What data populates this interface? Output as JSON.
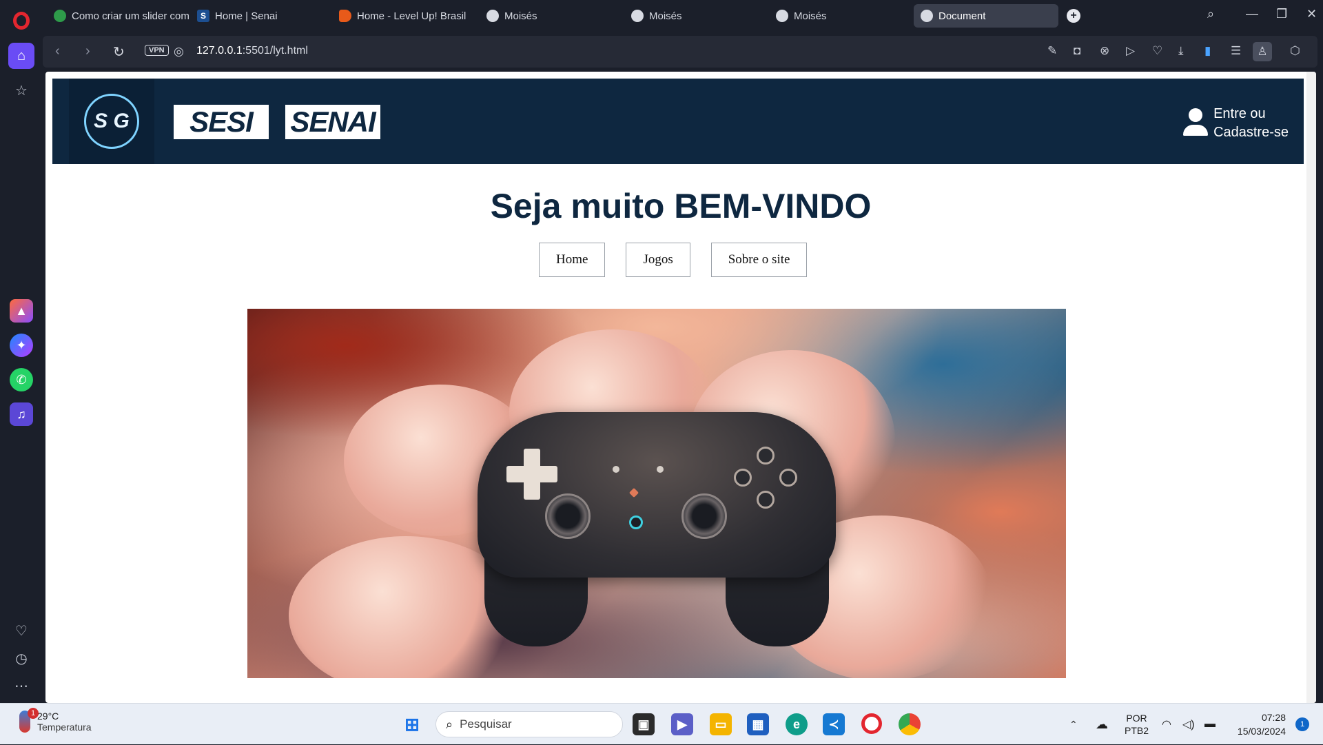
{
  "browser": {
    "tabs": [
      {
        "label": "Como criar um slider com",
        "favicon_color": "#2e9b4a"
      },
      {
        "label": "Home | Senai",
        "favicon_color": "#1d4f91",
        "favicon_text": "S"
      },
      {
        "label": "Home - Level Up! Brasil",
        "favicon_color": "#e85a1a"
      },
      {
        "label": "Moisés",
        "favicon_color": "#d7dae2"
      },
      {
        "label": "Moisés",
        "favicon_color": "#d7dae2"
      },
      {
        "label": "Moisés",
        "favicon_color": "#d7dae2"
      },
      {
        "label": "Document",
        "favicon_color": "#d7dae2",
        "active": true
      }
    ],
    "vpn_label": "VPN",
    "url_host": "127.0.0.1",
    "url_rest": ":5501/lyt.html"
  },
  "site": {
    "logo_text": "S G",
    "brand1": "SESI",
    "brand2": "SENAI",
    "login_line1": "Entre ou",
    "login_line2": "Cadastre-se",
    "welcome": "Seja muito BEM-VINDO",
    "menu": [
      "Home",
      "Jogos",
      "Sobre o site"
    ],
    "header_color": "#0e2740"
  },
  "taskbar": {
    "weather_temp": "29°C",
    "weather_label": "Temperatura",
    "weather_badge": "1",
    "search_placeholder": "Pesquisar",
    "lang1": "POR",
    "lang2": "PTB2",
    "time": "07:28",
    "date": "15/03/2024",
    "notifications": "1"
  }
}
